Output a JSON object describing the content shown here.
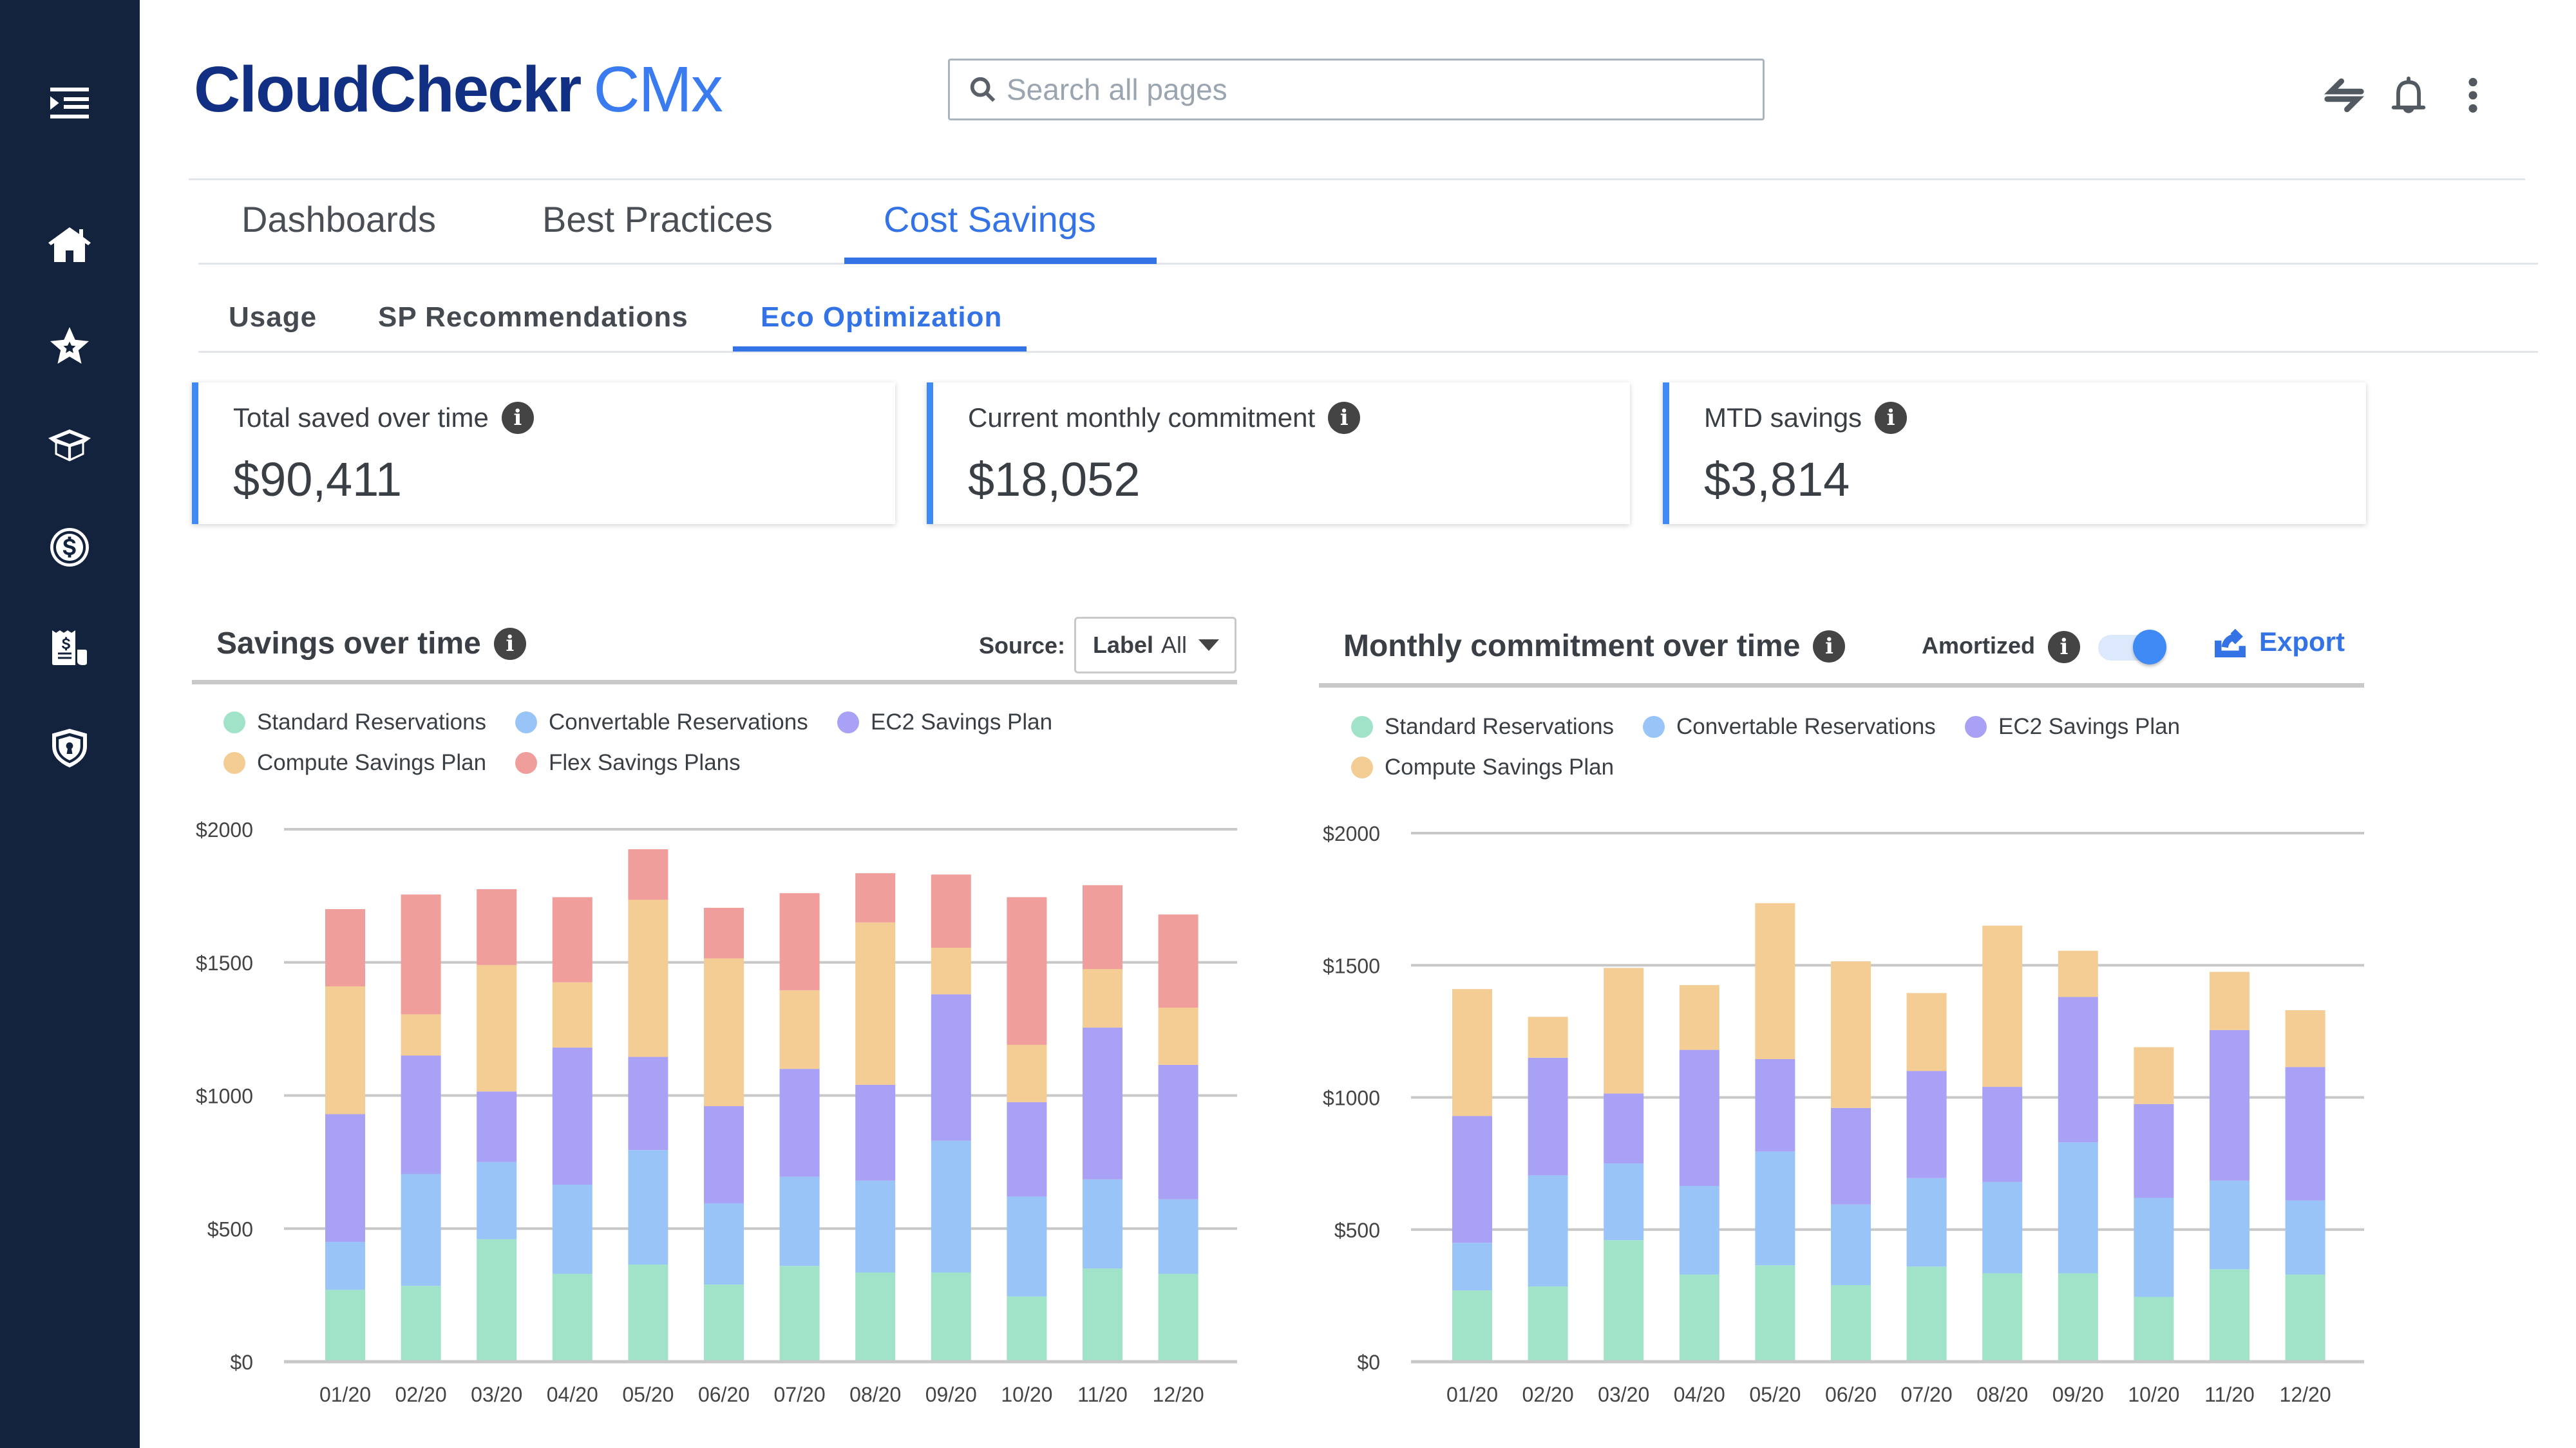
{
  "app": {
    "logo_brand": "CloudCheckr",
    "logo_product": "CMx"
  },
  "sidebar": {
    "items": [
      {
        "name": "menu-toggle",
        "icon": "menu-expand-icon"
      },
      {
        "name": "home",
        "icon": "home-icon"
      },
      {
        "name": "favorites",
        "icon": "star-icon"
      },
      {
        "name": "inventory",
        "icon": "box-icon"
      },
      {
        "name": "cost",
        "icon": "dollar-coin-icon"
      },
      {
        "name": "billing",
        "icon": "invoice-icon"
      },
      {
        "name": "security",
        "icon": "shield-lock-icon"
      }
    ]
  },
  "header": {
    "search_placeholder": "Search all pages",
    "icons": [
      "switch-account-icon",
      "bell-icon",
      "more-vertical-icon"
    ]
  },
  "tabs": {
    "main": [
      {
        "label": "Dashboards",
        "active": false
      },
      {
        "label": "Best Practices",
        "active": false
      },
      {
        "label": "Cost Savings",
        "active": true
      }
    ],
    "sub": [
      {
        "label": "Usage",
        "active": false
      },
      {
        "label": "SP Recommendations",
        "active": false
      },
      {
        "label": "Eco Optimization",
        "active": true
      }
    ]
  },
  "kpis": [
    {
      "label": "Total saved over time",
      "value": "$90,411"
    },
    {
      "label": "Current monthly commitment",
      "value": "$18,052"
    },
    {
      "label": "MTD savings",
      "value": "$3,814"
    }
  ],
  "info_glyph": "i",
  "savings_panel": {
    "title": "Savings over time",
    "source_label": "Source:",
    "source_select_prefix": "Label",
    "source_select_value": "All"
  },
  "commitment_panel": {
    "title": "Monthly commitment over time",
    "amortized_label": "Amortized",
    "amortized_on": true,
    "export_label": "Export"
  },
  "colors": {
    "accent": "#3373e6",
    "sidebar": "#14233d",
    "standard_reservations": "#a1e3c8",
    "convertable_reservations": "#98c4f8",
    "ec2_savings_plan": "#a9a1f5",
    "compute_savings_plan": "#f3cd94",
    "flex_savings_plans": "#f09e9b"
  },
  "chart_data": [
    {
      "type": "bar",
      "stacked": true,
      "title": "Savings over time",
      "xlabel": "",
      "ylabel": "",
      "ylim": [
        0,
        2000
      ],
      "yticks": [
        0,
        500,
        1000,
        1500,
        2000
      ],
      "ytick_labels": [
        "$0",
        "$500",
        "$1000",
        "$1500",
        "$2000"
      ],
      "grid": true,
      "legend_position": "top-left",
      "categories": [
        "01/20",
        "02/20",
        "03/20",
        "04/20",
        "05/20",
        "06/20",
        "07/20",
        "08/20",
        "09/20",
        "10/20",
        "11/20",
        "12/20"
      ],
      "series": [
        {
          "name": "Standard Reservations",
          "color": "#a1e3c8",
          "values": [
            270,
            285,
            460,
            330,
            365,
            290,
            360,
            335,
            335,
            245,
            350,
            330
          ]
        },
        {
          "name": "Convertable Reservations",
          "color": "#98c4f8",
          "values": [
            180,
            420,
            290,
            335,
            430,
            305,
            335,
            345,
            495,
            375,
            335,
            280
          ]
        },
        {
          "name": "EC2 Savings Plan",
          "color": "#a9a1f5",
          "values": [
            480,
            445,
            265,
            515,
            350,
            365,
            405,
            360,
            550,
            355,
            570,
            505
          ]
        },
        {
          "name": "Compute Savings Plan",
          "color": "#f3cd94",
          "values": [
            480,
            155,
            475,
            245,
            590,
            555,
            295,
            610,
            175,
            215,
            220,
            215
          ]
        },
        {
          "name": "Flex Savings Plans",
          "color": "#f09e9b",
          "values": [
            290,
            450,
            285,
            320,
            190,
            190,
            365,
            185,
            275,
            555,
            315,
            350
          ]
        }
      ]
    },
    {
      "type": "bar",
      "stacked": true,
      "title": "Monthly commitment over time",
      "xlabel": "",
      "ylabel": "",
      "ylim": [
        0,
        2000
      ],
      "yticks": [
        0,
        500,
        1000,
        1500,
        2000
      ],
      "ytick_labels": [
        "$0",
        "$500",
        "$1000",
        "$1500",
        "$2000"
      ],
      "grid": true,
      "legend_position": "top-left",
      "categories": [
        "01/20",
        "02/20",
        "03/20",
        "04/20",
        "05/20",
        "06/20",
        "07/20",
        "08/20",
        "09/20",
        "10/20",
        "11/20",
        "12/20"
      ],
      "series": [
        {
          "name": "Standard Reservations",
          "color": "#a1e3c8",
          "values": [
            270,
            285,
            460,
            330,
            365,
            290,
            360,
            335,
            335,
            245,
            350,
            330
          ]
        },
        {
          "name": "Convertable Reservations",
          "color": "#98c4f8",
          "values": [
            180,
            420,
            290,
            335,
            430,
            305,
            335,
            345,
            495,
            375,
            335,
            280
          ]
        },
        {
          "name": "EC2 Savings Plan",
          "color": "#a9a1f5",
          "values": [
            480,
            445,
            265,
            515,
            350,
            365,
            405,
            360,
            550,
            355,
            570,
            505
          ]
        },
        {
          "name": "Compute Savings Plan",
          "color": "#f3cd94",
          "values": [
            480,
            155,
            475,
            245,
            590,
            555,
            295,
            610,
            175,
            215,
            220,
            215
          ]
        }
      ]
    }
  ]
}
